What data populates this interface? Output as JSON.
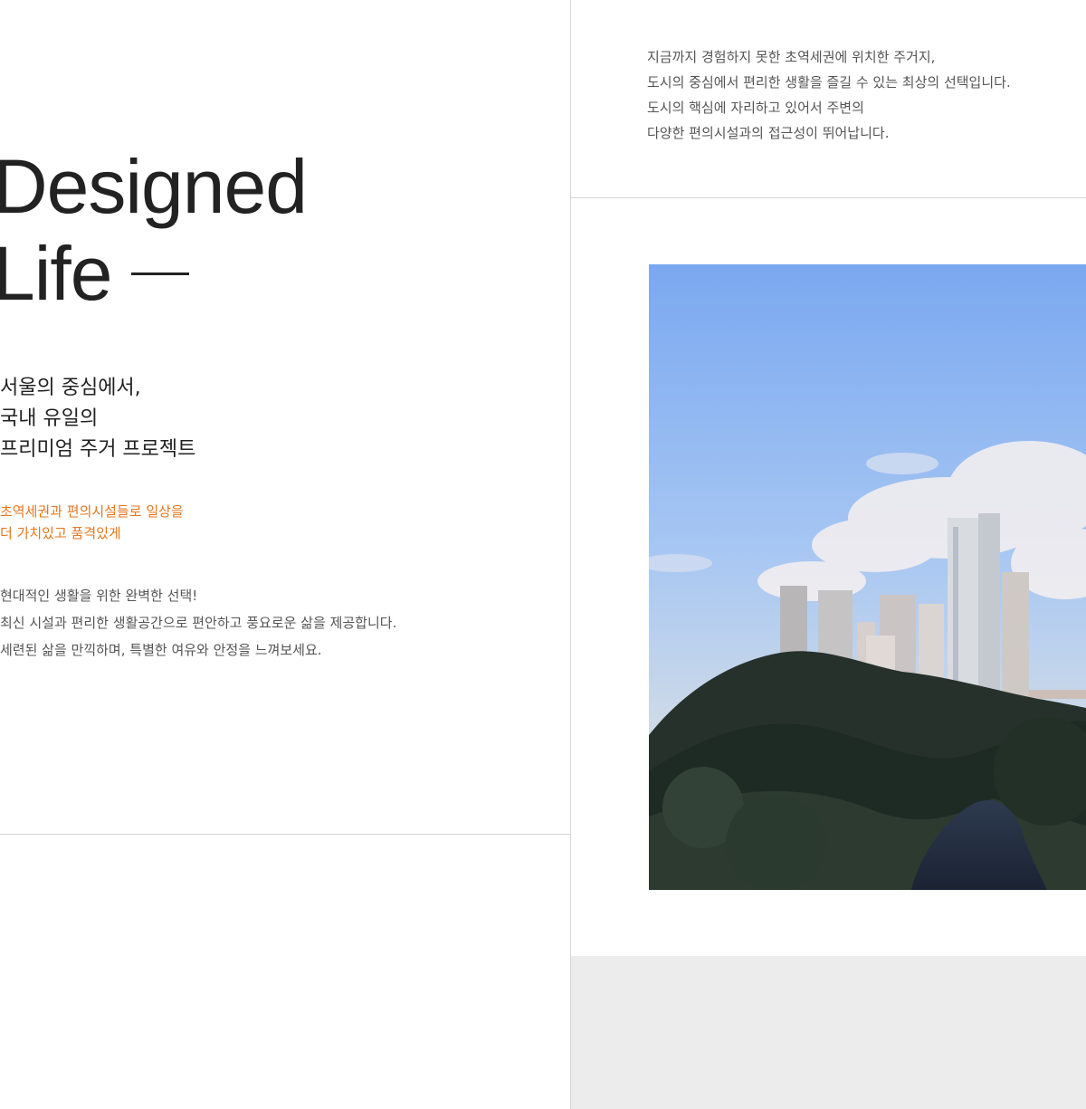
{
  "hero": {
    "title_line1": "Designed",
    "title_line2": "Life"
  },
  "subheading": {
    "line1": "서울의 중심에서,",
    "line2": "국내 유일의",
    "line3": "프리미엄 주거 프로젝트"
  },
  "highlight": {
    "line1": "초역세권과 편의시설들로 일상을",
    "line2": "더  가치있고 품격있게",
    "color": "#e8761d"
  },
  "body": {
    "line1": "현대적인 생활을 위한 완벽한 선택!",
    "line2": "최신 시설과 편리한 생활공간으로 편안하고 풍요로운 삶을 제공합니다.",
    "line3": "세련된 삶을 만끽하며, 특별한 여유와 안정을 느껴보세요."
  },
  "intro": {
    "line1": "지금까지 경험하지 못한 초역세권에 위치한 주거지,",
    "line2": "도시의 중심에서 편리한 생활을 즐길 수 있는 최상의 선택입니다.",
    "line3": "도시의 핵심에 자리하고 있어서 주변의",
    "line4": "다양한 편의시설과의 접근성이 뛰어납니다."
  },
  "photo": {
    "subject": "city-skyline-over-forest-and-stream"
  },
  "colors": {
    "text": "#222222",
    "muted": "#555555",
    "divider": "#d6d6d6",
    "accent": "#e8761d",
    "panel": "#ececec"
  }
}
